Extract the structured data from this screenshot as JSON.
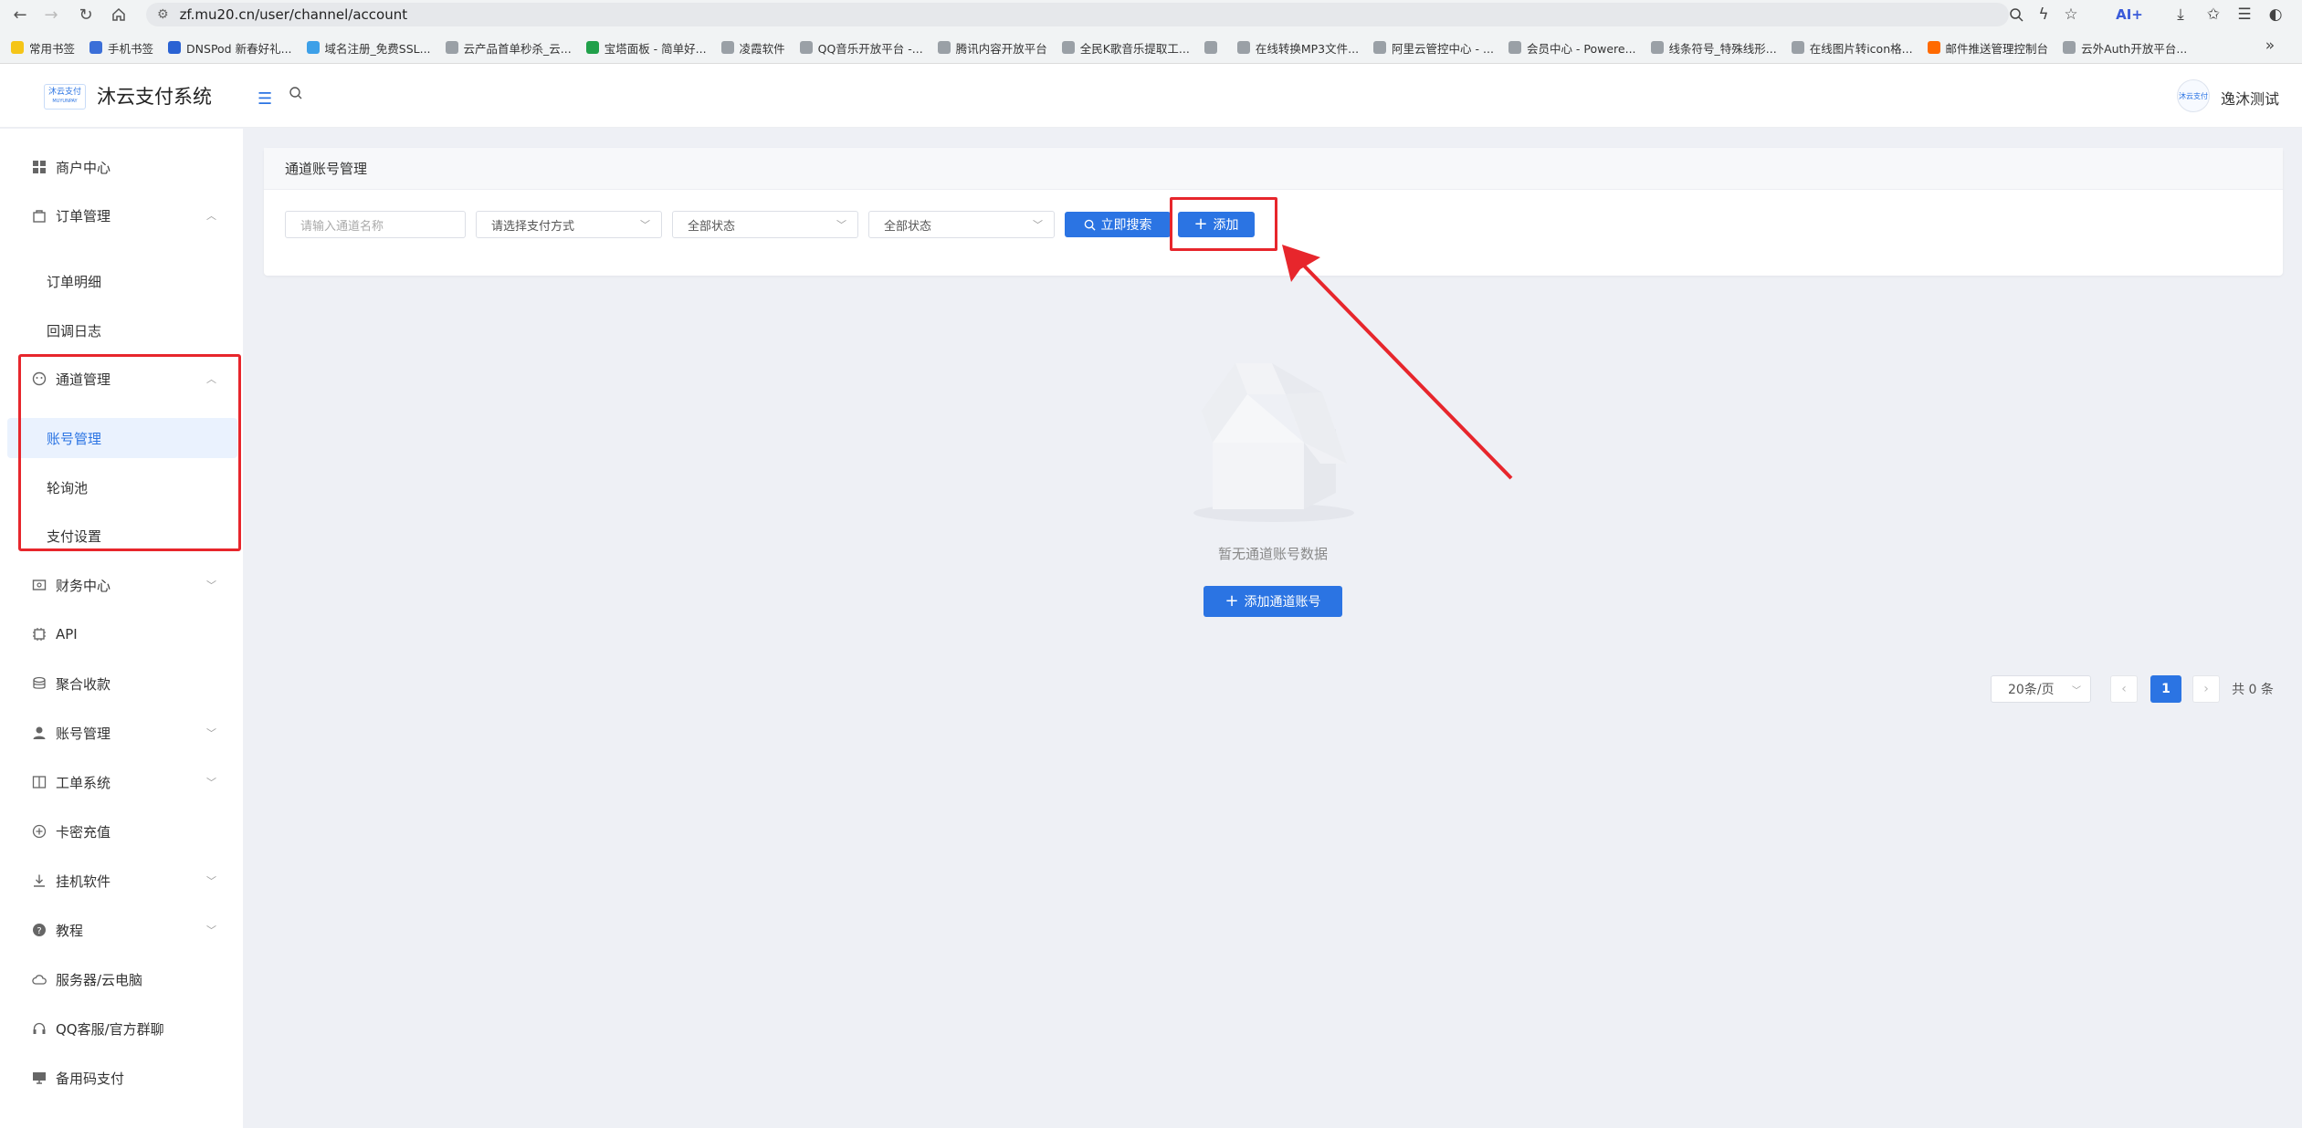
{
  "browser": {
    "url": "zf.mu20.cn/user/channel/account",
    "ai_label": "AI+",
    "bookmarks": [
      {
        "label": "常用书签",
        "color": "#f5c518"
      },
      {
        "label": "手机书签",
        "color": "#3b6fd8"
      },
      {
        "label": "DNSPod 新春好礼...",
        "color": "#2a62d3"
      },
      {
        "label": "域名注册_免费SSL...",
        "color": "#3da0e8"
      },
      {
        "label": "云产品首单秒杀_云...",
        "color": "#9aa0a6"
      },
      {
        "label": "宝塔面板 - 简单好...",
        "color": "#21a04a"
      },
      {
        "label": "凌霞软件",
        "color": "#9aa0a6"
      },
      {
        "label": "QQ音乐开放平台 -...",
        "color": "#9aa0a6"
      },
      {
        "label": "腾讯内容开放平台",
        "color": "#9aa0a6"
      },
      {
        "label": "全民K歌音乐提取工...",
        "color": "#9aa0a6"
      },
      {
        "label": "",
        "color": "#9aa0a6"
      },
      {
        "label": "在线转换MP3文件...",
        "color": "#9aa0a6"
      },
      {
        "label": "阿里云管控中心 - ...",
        "color": "#9aa0a6"
      },
      {
        "label": "会员中心 - Powere...",
        "color": "#9aa0a6"
      },
      {
        "label": "线条符号_特殊线形...",
        "color": "#9aa0a6"
      },
      {
        "label": "在线图片转icon格...",
        "color": "#9aa0a6"
      },
      {
        "label": "邮件推送管理控制台",
        "color": "#ff6a00"
      },
      {
        "label": "云外Auth开放平台...",
        "color": "#9aa0a6"
      }
    ]
  },
  "header": {
    "logo_text_top": "沐云支付",
    "logo_text_bottom": "MUYUNPAY",
    "brand": "沐云支付系统",
    "avatar_text": "沐云支付",
    "username": "逸沐测试"
  },
  "sidebar": {
    "items": [
      {
        "label": "商户中心",
        "icon": "grid-icon"
      },
      {
        "label": "订单管理",
        "icon": "bag-icon",
        "expanded": true
      },
      {
        "label": "订单明细"
      },
      {
        "label": "回调日志"
      },
      {
        "label": "通道管理",
        "icon": "channel-icon",
        "expanded": true
      },
      {
        "label": "账号管理",
        "active": true
      },
      {
        "label": "轮询池"
      },
      {
        "label": "支付设置"
      },
      {
        "label": "财务中心",
        "icon": "finance-icon"
      },
      {
        "label": "API",
        "icon": "chip-icon"
      },
      {
        "label": "聚合收款",
        "icon": "coins-icon"
      },
      {
        "label": "账号管理",
        "icon": "user-icon"
      },
      {
        "label": "工单系统",
        "icon": "book-icon"
      },
      {
        "label": "卡密充值",
        "icon": "plus-circle-icon"
      },
      {
        "label": "挂机软件",
        "icon": "download-icon"
      },
      {
        "label": "教程",
        "icon": "help-icon"
      },
      {
        "label": "服务器/云电脑",
        "icon": "cloud-icon"
      },
      {
        "label": "QQ客服/官方群聊",
        "icon": "headset-icon"
      },
      {
        "label": "备用码支付",
        "icon": "monitor-icon"
      }
    ]
  },
  "main": {
    "card_title": "通道账号管理",
    "filters": {
      "name_placeholder": "请输入通道名称",
      "pay_method": "请选择支付方式",
      "status1": "全部状态",
      "status2": "全部状态"
    },
    "search_button": "立即搜索",
    "add_button": "添加",
    "empty_text": "暂无通道账号数据",
    "empty_add_button": "添加通道账号",
    "pagination": {
      "page_size": "20条/页",
      "current_page": "1",
      "total": "共 0 条"
    }
  },
  "colors": {
    "primary": "#2b74e3",
    "highlight": "#e7262c",
    "background": "#eef0f5"
  }
}
